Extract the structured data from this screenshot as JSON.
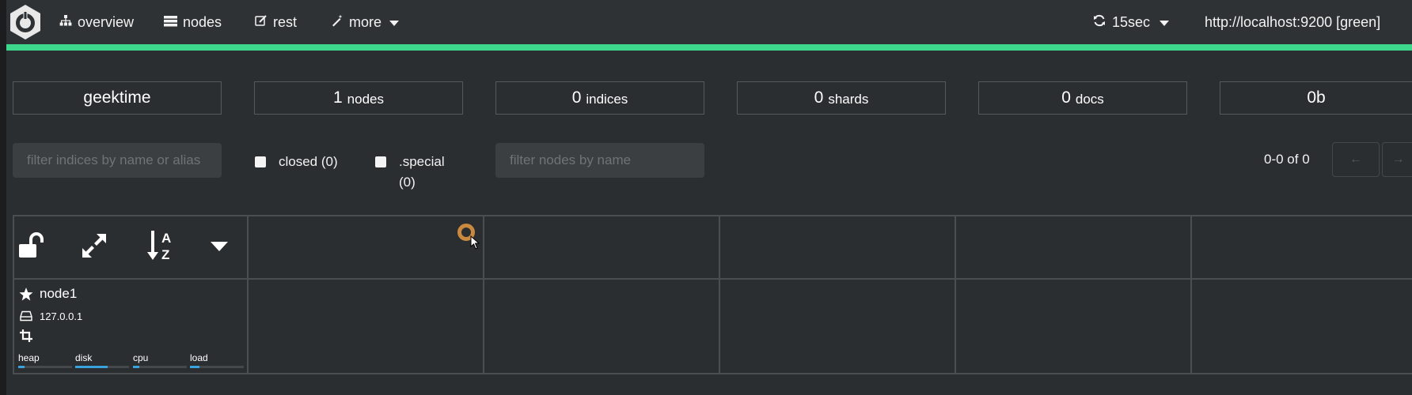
{
  "nav": {
    "items": [
      {
        "label": "overview",
        "icon": "sitemap-icon"
      },
      {
        "label": "nodes",
        "icon": "server-icon"
      },
      {
        "label": "rest",
        "icon": "edit-icon"
      },
      {
        "label": "more",
        "icon": "magic-wand-icon"
      }
    ],
    "refresh_interval": "15sec",
    "cluster_url": "http://localhost:9200 [green]",
    "accent_color": "#3ed88d"
  },
  "stats": {
    "cluster_name": "geektime",
    "nodes": {
      "num": "1",
      "label": "nodes"
    },
    "indices": {
      "num": "0",
      "label": "indices"
    },
    "shards": {
      "num": "0",
      "label": "shards"
    },
    "docs": {
      "num": "0",
      "label": "docs"
    },
    "size": "0b"
  },
  "filters": {
    "indices_placeholder": "filter indices by name or alias",
    "closed_label": "closed (0)",
    "special_label": ".special",
    "special_count": "(0)",
    "nodes_placeholder": "filter nodes by name",
    "pagination": "0-0 of 0",
    "prev_symbol": "←",
    "next_symbol": "→"
  },
  "node": {
    "name": "node1",
    "ip": "127.0.0.1",
    "metrics": [
      {
        "label": "heap",
        "value": 0.12
      },
      {
        "label": "disk",
        "value": 0.6
      },
      {
        "label": "cpu",
        "value": 0.12
      },
      {
        "label": "load",
        "value": 0.18
      }
    ],
    "metric_color": "#3aa3dd"
  }
}
